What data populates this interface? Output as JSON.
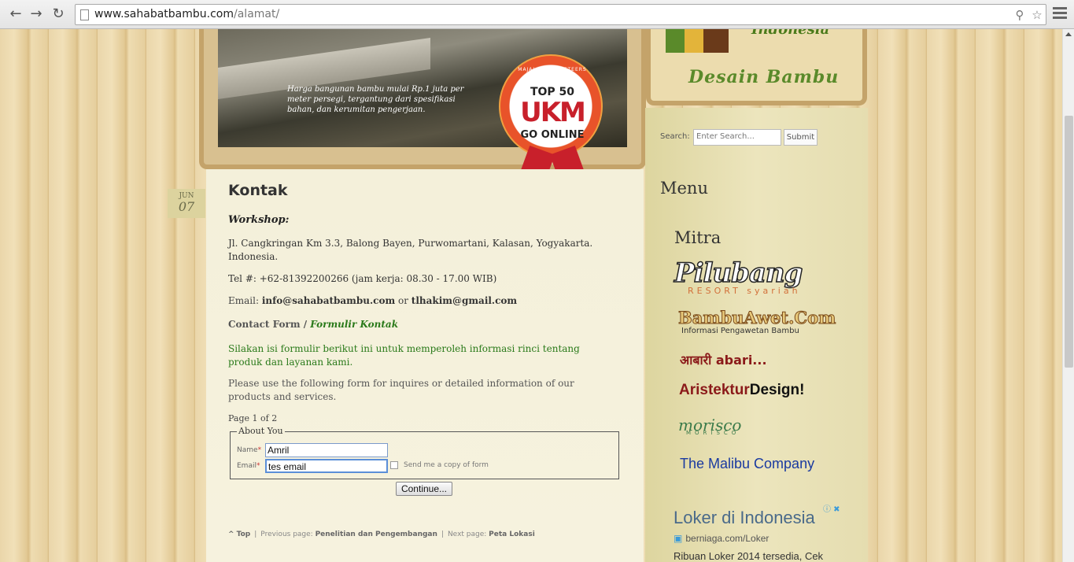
{
  "browser": {
    "url_host": "www.sahabatbambu.com",
    "url_path": "/alamat/"
  },
  "banner": {
    "caption": "Harga bangunan bambu mulai Rp.1 juta per meter persegi, tergantung dari spesifikasi bahan, dan kerumitan pengerjaan.",
    "badge_arc": "MAJALAH MARKETEERS",
    "badge_top": "TOP 50",
    "badge_main": "UKM",
    "badge_bottom": "GO ONLINE"
  },
  "logo": {
    "country": "Indonesia",
    "tagline": "Desain Bambu"
  },
  "sidebar": {
    "search_label": "Search:",
    "search_placeholder": "Enter Search...",
    "submit_label": "Submit",
    "menu_heading": "Menu",
    "mitra_heading": "Mitra",
    "partners": {
      "pilubang": "Pilubang",
      "pilubang_sub": "RESORT syariah",
      "bambuawet": "BambuAwet.Com",
      "bambuawet_sub": "Informasi Pengawetan Bambu",
      "abari": "आबारी abari...",
      "arsi_a": "Aristektur",
      "arsi_b": "Design!",
      "morisco_script": "morisco",
      "morisco_text": "MORISCO",
      "malibu": "The Malibu Company"
    },
    "ad": {
      "title": "Loker di Indonesia",
      "url": "berniaga.com/Loker",
      "text": "Ribuan Loker 2014 tersedia, Cek"
    }
  },
  "post": {
    "month": "JUN",
    "day": "07",
    "title": "Kontak",
    "workshop": "Workshop:",
    "address": "Jl. Cangkringan Km 3.3, Balong Bayen, Purwomartani, Kalasan, Yogyakarta. Indonesia.",
    "tel": "Tel #: +62-81392200266  (jam kerja: 08.30 - 17.00 WIB)",
    "email_prefix": "Email: ",
    "email_1": "info@sahabatbambu.com",
    "email_or": " or ",
    "email_2": "tlhakim@gmail.com",
    "cf_prefix": "Contact Form / ",
    "cf_link": "Formulir Kontak",
    "silakan": "Silakan isi formulir berikut ini untuk memperoleh informasi rinci tentang produk dan layanan kami.",
    "please": "Please use the following form for inquires or detailed information of our products and services.",
    "page_count": "Page 1 of 2"
  },
  "form": {
    "legend": "About You",
    "name_label": "Name",
    "email_label": "Email",
    "required_mark": "*",
    "name_value": "Amril",
    "email_value": "tes email",
    "send_copy_label": "Send me a copy of form",
    "continue_label": "Continue..."
  },
  "footer_nav": {
    "top": "^ Top",
    "prev_label": "Previous page: ",
    "prev_page": "Penelitian dan Pengembangan",
    "next_label": "Next page: ",
    "next_page": "Peta Lokasi",
    "separator": "|"
  }
}
